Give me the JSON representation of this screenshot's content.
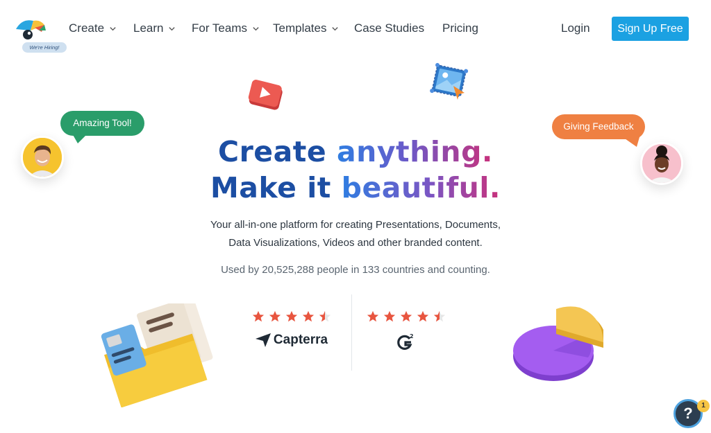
{
  "nav": {
    "hiring_badge": "We're Hiring!",
    "items": [
      {
        "label": "Create",
        "has_dropdown": true
      },
      {
        "label": "Learn",
        "has_dropdown": true
      },
      {
        "label": "For Teams",
        "has_dropdown": true
      },
      {
        "label": "Templates",
        "has_dropdown": true
      },
      {
        "label": "Case Studies",
        "has_dropdown": false
      },
      {
        "label": "Pricing",
        "has_dropdown": false
      }
    ],
    "login_label": "Login",
    "signup_label": "Sign Up Free"
  },
  "hero": {
    "line1_part1": "Create",
    "line1_part2": "anything.",
    "line2_part1": "Make it",
    "line2_part2": "beautiful.",
    "subtitle_line1": "Your all-in-one platform for creating Presentations, Documents,",
    "subtitle_line2": "Data Visualizations, Videos and other branded content.",
    "usage": "Used by 20,525,288 people in 133 countries and counting."
  },
  "bubbles": {
    "left": "Amazing Tool!",
    "right": "Giving Feedback"
  },
  "ratings": [
    {
      "brand": "Capterra",
      "stars": 4.5
    },
    {
      "brand": "G2",
      "stars": 4.5
    }
  ],
  "help": {
    "icon": "?",
    "badge_count": "1"
  },
  "colors": {
    "accent": "#1ba1e2",
    "headline_dark": "#1c4ea3",
    "star": "#e8553f",
    "bubble_green": "#2a9d6a",
    "bubble_orange": "#ef8042"
  }
}
